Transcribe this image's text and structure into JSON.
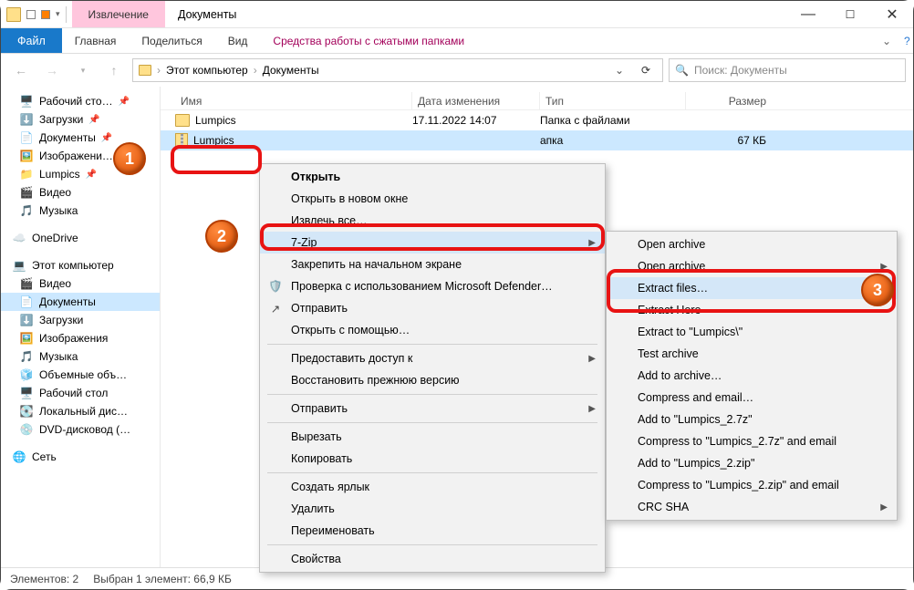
{
  "title": {
    "tools": "Извлечение",
    "docs": "Документы"
  },
  "ribbon": {
    "file": "Файл",
    "home": "Главная",
    "share": "Поделиться",
    "view": "Вид",
    "tools": "Средства работы с сжатыми папками"
  },
  "breadcrumb": {
    "a": "Этот компьютер",
    "b": "Документы"
  },
  "search": {
    "placeholder": "Поиск: Документы"
  },
  "columns": {
    "name": "Имя",
    "date": "Дата изменения",
    "type": "Тип",
    "size": "Размер"
  },
  "rows": [
    {
      "name": "Lumpics",
      "date": "17.11.2022 14:07",
      "type": "Папка с файлами",
      "size": ""
    },
    {
      "name": "Lumpics",
      "date": "",
      "type": "апка",
      "size": "67 КБ"
    }
  ],
  "nav": {
    "desktop": "Рабочий сто…",
    "downloads": "Загрузки",
    "documents": "Документы",
    "pictures": "Изображени…",
    "lumpics": "Lumpics",
    "videos": "Видео",
    "music": "Музыка",
    "onedrive": "OneDrive",
    "thispc": "Этот компьютер",
    "videos2": "Видео",
    "documents2": "Документы",
    "downloads2": "Загрузки",
    "pictures2": "Изображения",
    "music2": "Музыка",
    "objects3d": "Объемные объ…",
    "desktop2": "Рабочий стол",
    "localdisk": "Локальный дис…",
    "dvd": "DVD-дисковод (…",
    "network": "Сеть"
  },
  "ctx1": {
    "open": "Открыть",
    "new_window": "Открыть в новом окне",
    "extract_all": "Извлечь все…",
    "sevenzip": "7-Zip",
    "pin_start": "Закрепить на начальном экране",
    "defender": "Проверка с использованием Microsoft Defender…",
    "send": "Отправить",
    "open_with": "Открыть с помощью…",
    "give_access": "Предоставить доступ к",
    "restore": "Восстановить прежнюю версию",
    "send_to": "Отправить",
    "cut": "Вырезать",
    "copy": "Копировать",
    "shortcut": "Создать ярлык",
    "delete": "Удалить",
    "rename": "Переименовать",
    "properties": "Свойства"
  },
  "ctx2": {
    "open_archive": "Open archive",
    "open_archive2": "Open archive",
    "extract_files": "Extract files…",
    "extract_here": "Extract Here",
    "extract_to": "Extract to \"Lumpics\\\"",
    "test": "Test archive",
    "add": "Add to archive…",
    "compress_email": "Compress and email…",
    "add_7z": "Add to \"Lumpics_2.7z\"",
    "compress_7z_email": "Compress to \"Lumpics_2.7z\" and email",
    "add_zip": "Add to \"Lumpics_2.zip\"",
    "compress_zip_email": "Compress to \"Lumpics_2.zip\" and email",
    "crc": "CRC SHA"
  },
  "status": {
    "count": "Элементов: 2",
    "sel": "Выбран 1 элемент: 66,9 КБ"
  },
  "markers": {
    "one": "1",
    "two": "2",
    "three": "3"
  }
}
